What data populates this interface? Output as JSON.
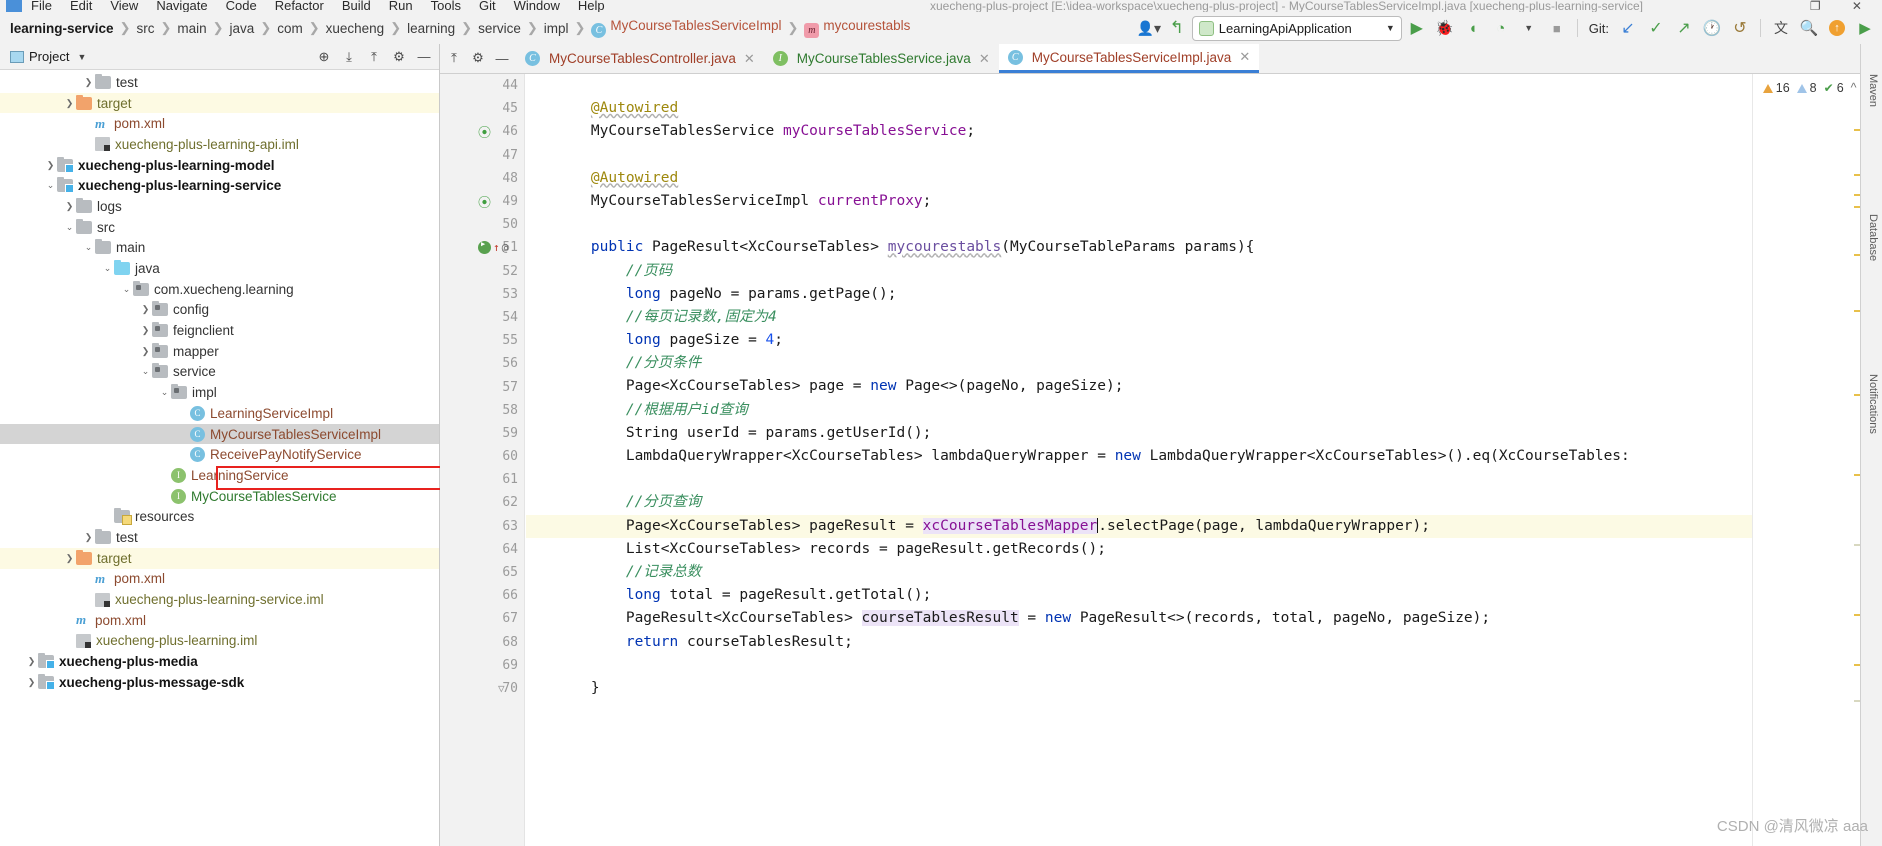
{
  "window": {
    "title": "xuecheng-plus-project [E:\\idea-workspace\\xuecheng-plus-project] - MyCourseTablesServiceImpl.java [xuecheng-plus-learning-service]",
    "menu": [
      "File",
      "Edit",
      "View",
      "Navigate",
      "Code",
      "Refactor",
      "Build",
      "Run",
      "Tools",
      "Git",
      "Window",
      "Help"
    ]
  },
  "breadcrumb": {
    "items": [
      {
        "label": "learning-service",
        "kind": "root"
      },
      {
        "label": "src",
        "kind": "dir"
      },
      {
        "label": "main",
        "kind": "dir"
      },
      {
        "label": "java",
        "kind": "dir"
      },
      {
        "label": "com",
        "kind": "dir"
      },
      {
        "label": "xuecheng",
        "kind": "dir"
      },
      {
        "label": "learning",
        "kind": "dir"
      },
      {
        "label": "service",
        "kind": "dir"
      },
      {
        "label": "impl",
        "kind": "dir"
      },
      {
        "label": "MyCourseTablesServiceImpl",
        "kind": "class"
      },
      {
        "label": "mycourestabls",
        "kind": "method"
      }
    ]
  },
  "toolbar": {
    "run_config": "LearningApiApplication",
    "git_label": "Git:",
    "run_icon": "run-icon",
    "debug_icon": "debug-icon",
    "coverage_icon": "coverage-icon",
    "profile_icon": "profile-icon",
    "stop_icon": "stop-icon",
    "update_project_icon": "update-project-icon",
    "commit_icon": "commit-icon",
    "push_icon": "push-icon",
    "history_icon": "history-icon",
    "rollback_icon": "rollback-icon",
    "translate_icon": "translate-icon",
    "search_everywhere_icon": "search-icon",
    "settings_icon": "gear-icon"
  },
  "project_panel": {
    "title": "Project",
    "tree": [
      {
        "label": "test",
        "indent": 4,
        "arrow": "right",
        "icon": "folder-grey",
        "style": "grey",
        "state": "normal"
      },
      {
        "label": "target",
        "indent": 3,
        "arrow": "right",
        "icon": "folder-orange",
        "style": "olive",
        "state": "hl"
      },
      {
        "label": "pom.xml",
        "indent": 4,
        "arrow": "none",
        "icon": "maven",
        "style": "brown",
        "state": "normal"
      },
      {
        "label": "xuecheng-plus-learning-api.iml",
        "indent": 4,
        "arrow": "none",
        "icon": "iml",
        "style": "olive",
        "state": "normal"
      },
      {
        "label": "xuecheng-plus-learning-model",
        "indent": 2,
        "arrow": "right",
        "icon": "folder-module",
        "style": "mod",
        "state": "normal"
      },
      {
        "label": "xuecheng-plus-learning-service",
        "indent": 2,
        "arrow": "down",
        "icon": "folder-module",
        "style": "mod",
        "state": "normal"
      },
      {
        "label": "logs",
        "indent": 3,
        "arrow": "right",
        "icon": "folder-grey",
        "style": "grey",
        "state": "normal"
      },
      {
        "label": "src",
        "indent": 3,
        "arrow": "down",
        "icon": "folder-grey",
        "style": "grey",
        "state": "normal"
      },
      {
        "label": "main",
        "indent": 4,
        "arrow": "down",
        "icon": "folder-grey",
        "style": "grey",
        "state": "normal"
      },
      {
        "label": "java",
        "indent": 5,
        "arrow": "down",
        "icon": "folder-blue",
        "style": "grey",
        "state": "normal"
      },
      {
        "label": "com.xuecheng.learning",
        "indent": 6,
        "arrow": "down",
        "icon": "folder-pkg",
        "style": "grey",
        "state": "normal"
      },
      {
        "label": "config",
        "indent": 7,
        "arrow": "right",
        "icon": "folder-pkg",
        "style": "grey",
        "state": "normal"
      },
      {
        "label": "feignclient",
        "indent": 7,
        "arrow": "right",
        "icon": "folder-pkg",
        "style": "grey",
        "state": "normal"
      },
      {
        "label": "mapper",
        "indent": 7,
        "arrow": "right",
        "icon": "folder-pkg",
        "style": "grey",
        "state": "normal"
      },
      {
        "label": "service",
        "indent": 7,
        "arrow": "down",
        "icon": "folder-pkg",
        "style": "grey",
        "state": "normal"
      },
      {
        "label": "impl",
        "indent": 8,
        "arrow": "down",
        "icon": "folder-pkg",
        "style": "grey",
        "state": "normal"
      },
      {
        "label": "LearningServiceImpl",
        "indent": 9,
        "arrow": "none",
        "icon": "class",
        "style": "brown",
        "state": "normal"
      },
      {
        "label": "MyCourseTablesServiceImpl",
        "indent": 9,
        "arrow": "none",
        "icon": "class",
        "style": "brown",
        "state": "sel"
      },
      {
        "label": "ReceivePayNotifyService",
        "indent": 9,
        "arrow": "none",
        "icon": "class",
        "style": "brown",
        "state": "normal"
      },
      {
        "label": "LearningService",
        "indent": 8,
        "arrow": "none",
        "icon": "interface",
        "style": "brown",
        "state": "normal"
      },
      {
        "label": "MyCourseTablesService",
        "indent": 8,
        "arrow": "none",
        "icon": "interface",
        "style": "green",
        "state": "normal"
      },
      {
        "label": "resources",
        "indent": 5,
        "arrow": "none",
        "icon": "folder-res",
        "style": "grey",
        "state": "normal"
      },
      {
        "label": "test",
        "indent": 4,
        "arrow": "right",
        "icon": "folder-grey",
        "style": "grey",
        "state": "normal"
      },
      {
        "label": "target",
        "indent": 3,
        "arrow": "right",
        "icon": "folder-orange",
        "style": "olive",
        "state": "hl"
      },
      {
        "label": "pom.xml",
        "indent": 4,
        "arrow": "none",
        "icon": "maven",
        "style": "brown",
        "state": "normal"
      },
      {
        "label": "xuecheng-plus-learning-service.iml",
        "indent": 4,
        "arrow": "none",
        "icon": "iml",
        "style": "olive",
        "state": "normal"
      },
      {
        "label": "pom.xml",
        "indent": 3,
        "arrow": "none",
        "icon": "maven",
        "style": "brown",
        "state": "normal"
      },
      {
        "label": "xuecheng-plus-learning.iml",
        "indent": 3,
        "arrow": "none",
        "icon": "iml",
        "style": "olive",
        "state": "normal"
      },
      {
        "label": "xuecheng-plus-media",
        "indent": 1,
        "arrow": "right",
        "icon": "folder-module",
        "style": "mod",
        "state": "normal"
      },
      {
        "label": "xuecheng-plus-message-sdk",
        "indent": 1,
        "arrow": "right",
        "icon": "folder-module",
        "style": "mod",
        "state": "normal"
      }
    ]
  },
  "editor": {
    "tabs": [
      {
        "label": "MyCourseTablesController.java",
        "icon": "class",
        "active": false
      },
      {
        "label": "MyCourseTablesService.java",
        "icon": "interface",
        "active": false
      },
      {
        "label": "MyCourseTablesServiceImpl.java",
        "icon": "class",
        "active": true
      }
    ],
    "first_line": 44,
    "lines": [
      {
        "n": 44,
        "html": "",
        "mark": "",
        "hl": false
      },
      {
        "n": 45,
        "html": "    <span class=\"ann wavy\">@Autowired</span>",
        "mark": "",
        "hl": false
      },
      {
        "n": 46,
        "html": "    MyCourseTablesService <span class=\"fld\">myCourseTablesService</span>;",
        "mark": "override",
        "hl": false
      },
      {
        "n": 47,
        "html": "",
        "mark": "",
        "hl": false
      },
      {
        "n": 48,
        "html": "    <span class=\"ann wavy\">@Autowired</span>",
        "mark": "",
        "hl": false
      },
      {
        "n": 49,
        "html": "    MyCourseTablesServiceImpl <span class=\"fld\">currentProxy</span>;",
        "mark": "override",
        "hl": false
      },
      {
        "n": 50,
        "html": "",
        "mark": "",
        "hl": false
      },
      {
        "n": 51,
        "html": "    <span class=\"kw\">public</span> PageResult&lt;XcCourseTables&gt; <span class=\"wavy\" style=\"color:#6b4fa0\">mycourestabls</span>(MyCourseTableParams params){",
        "mark": "run-at",
        "hl": false
      },
      {
        "n": 52,
        "html": "        <span class=\"cmt\">//页码</span>",
        "mark": "",
        "hl": false
      },
      {
        "n": 53,
        "html": "        <span class=\"kw\">long</span> pageNo = params.getPage();",
        "mark": "",
        "hl": false
      },
      {
        "n": 54,
        "html": "        <span class=\"cmt\">//每页记录数,固定为4</span>",
        "mark": "",
        "hl": false
      },
      {
        "n": 55,
        "html": "        <span class=\"kw\">long</span> pageSize = <span class=\"num\">4</span>;",
        "mark": "",
        "hl": false
      },
      {
        "n": 56,
        "html": "        <span class=\"cmt\">//分页条件</span>",
        "mark": "",
        "hl": false
      },
      {
        "n": 57,
        "html": "        Page&lt;XcCourseTables&gt; page = <span class=\"kw\">new</span> Page&lt;&gt;(pageNo, pageSize);",
        "mark": "",
        "hl": false
      },
      {
        "n": 58,
        "html": "        <span class=\"cmt\">//根据用户id查询</span>",
        "mark": "",
        "hl": false
      },
      {
        "n": 59,
        "html": "        String userId = params.getUserId();",
        "mark": "",
        "hl": false
      },
      {
        "n": 60,
        "html": "        LambdaQueryWrapper&lt;XcCourseTables&gt; lambdaQueryWrapper = <span class=\"kw\">new</span> LambdaQueryWrapper&lt;XcCourseTables&gt;().eq(XcCourseTables:",
        "mark": "",
        "hl": false
      },
      {
        "n": 61,
        "html": "",
        "mark": "",
        "hl": false
      },
      {
        "n": 62,
        "html": "        <span class=\"cmt\">//分页查询</span>",
        "mark": "",
        "hl": false
      },
      {
        "n": 63,
        "html": "        Page&lt;XcCourseTables&gt; pageResult = <span class=\"hlbox fld\">xcCourseTablesMapper</span><span class=\"caret\"></span>.selectPage(page, lambdaQueryWrapper);",
        "mark": "",
        "hl": true
      },
      {
        "n": 64,
        "html": "        List&lt;XcCourseTables&gt; records = pageResult.getRecords();",
        "mark": "",
        "hl": false
      },
      {
        "n": 65,
        "html": "        <span class=\"cmt\">//记录总数</span>",
        "mark": "",
        "hl": false
      },
      {
        "n": 66,
        "html": "        <span class=\"kw\">long</span> total = pageResult.getTotal();",
        "mark": "",
        "hl": false
      },
      {
        "n": 67,
        "html": "        PageResult&lt;XcCourseTables&gt; <span class=\"hlbox\">courseTablesResult</span> = <span class=\"kw\">new</span> PageResult&lt;&gt;(records, total, pageNo, pageSize);",
        "mark": "",
        "hl": false
      },
      {
        "n": 68,
        "html": "        <span class=\"kw\">return</span> courseTablesResult;",
        "mark": "",
        "hl": false
      },
      {
        "n": 69,
        "html": "",
        "mark": "",
        "hl": false
      },
      {
        "n": 70,
        "html": "    }",
        "mark": "fold-end",
        "hl": false
      }
    ]
  },
  "inspection": {
    "warnings": "16",
    "weak_warnings": "8",
    "typos": "6",
    "warning_icon": "warning-triangle-icon",
    "weak_warning_icon": "weak-warning-triangle-icon",
    "typo_icon": "typo-check-icon",
    "prev_icon": "chevron-up-icon",
    "next_icon": "chevron-down-icon"
  },
  "right_strip": {
    "labels": [
      "Maven",
      "Database",
      "Notifications"
    ]
  },
  "watermark": "CSDN @清风微凉 aaa"
}
